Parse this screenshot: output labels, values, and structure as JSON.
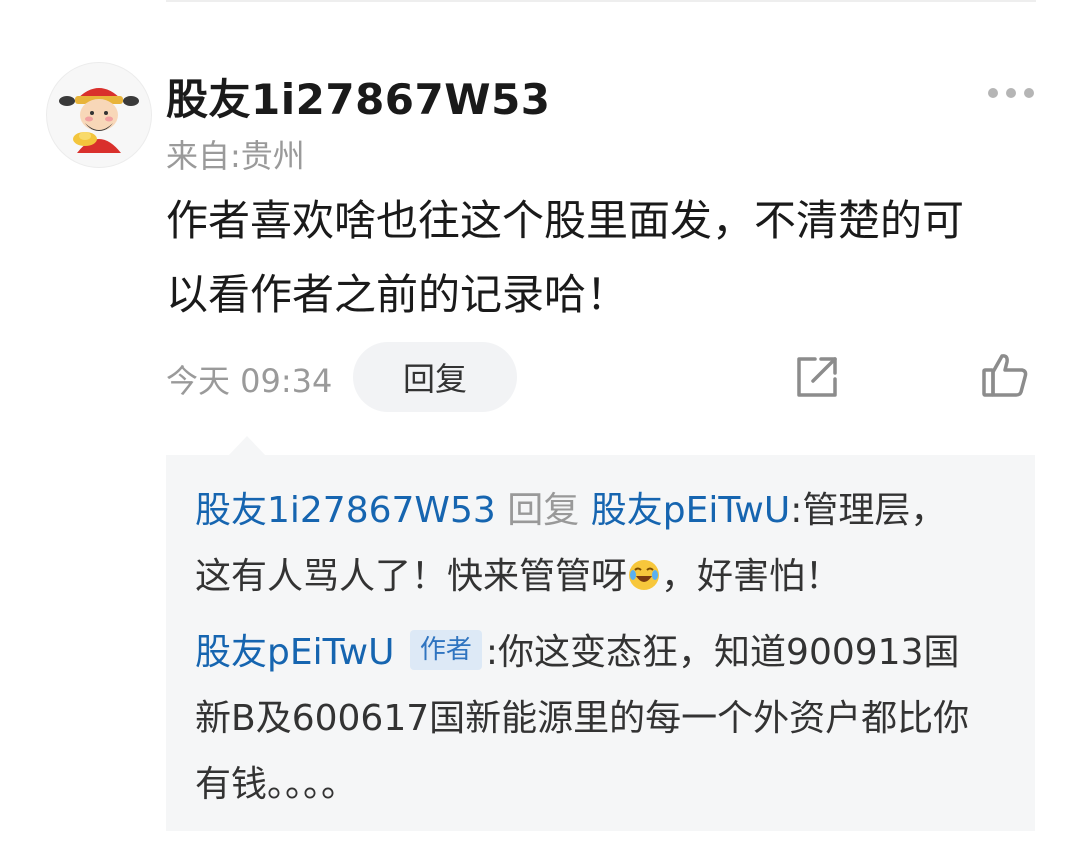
{
  "comment": {
    "username": "股友1i27867W53",
    "location": "来自:贵州",
    "text_lines": [
      "作者喜欢啥也往这个股里面发，不清楚的可",
      "以看作者之前的记录哈！"
    ],
    "timestamp": "今天 09:34",
    "reply_button": "回复",
    "more_icon": "more-dots-icon",
    "share_icon": "share-icon",
    "like_icon": "thumbs-up-icon"
  },
  "replies": [
    {
      "author": "股友1i27867W53",
      "reply_word": "回复",
      "target": "股友pEiTwU",
      "separator": ":",
      "text_line1": "管理层，",
      "text_line2_before_emoji": "这有人骂人了！快来管管呀",
      "emoji": "crying-laughing-emoji",
      "text_line2_after_emoji": "，好害怕！"
    },
    {
      "author": "股友pEiTwU",
      "badge": "作者",
      "separator": ":",
      "text_line1": "你这变态狂，知道900913国",
      "text_line2": "新B及600617国新能源里的每一个外资户都比你",
      "text_line3": "有钱。。。。"
    }
  ],
  "colors": {
    "link_blue": "#1665b0",
    "badge_bg": "#dde9f6",
    "reply_box_bg": "#f5f6f7",
    "muted_gray": "#9a9a9a"
  }
}
